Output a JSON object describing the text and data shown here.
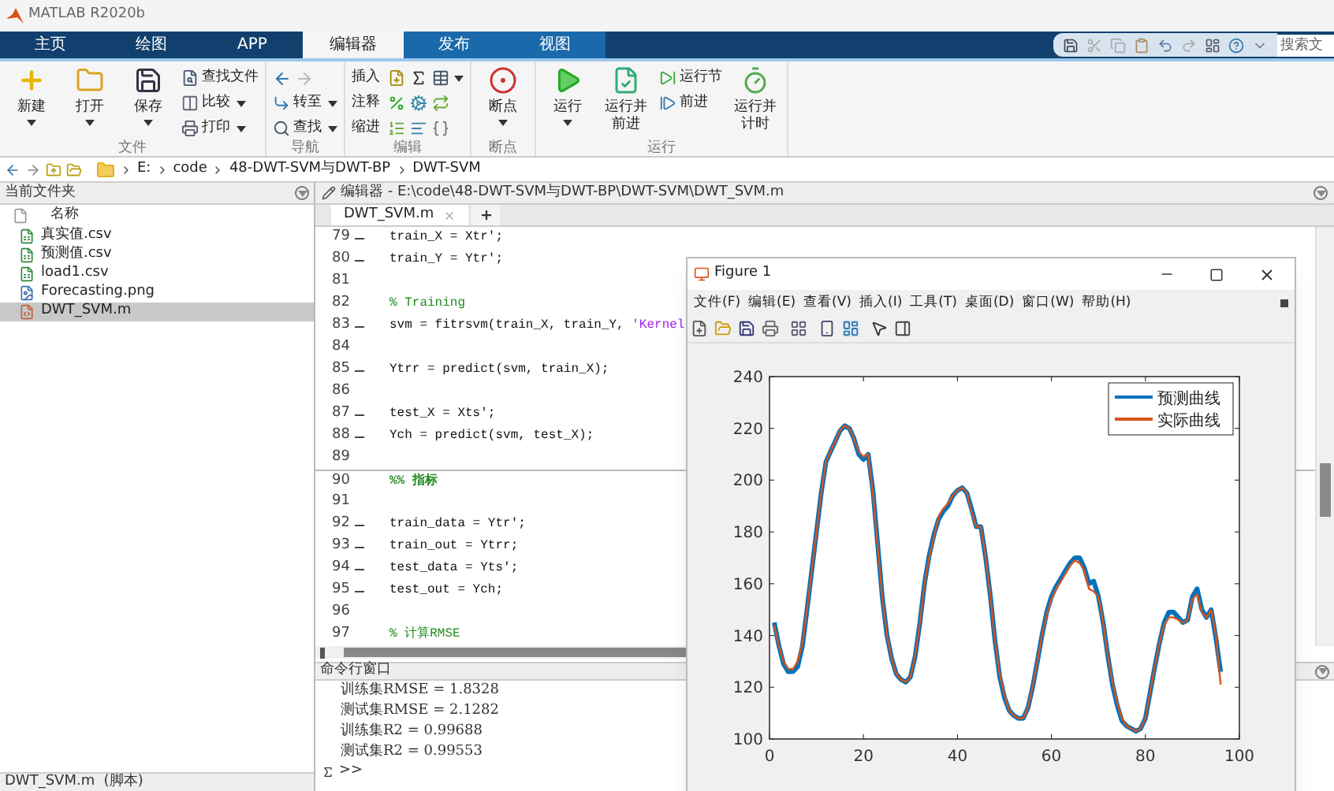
{
  "app_title": "MATLAB R2020b",
  "tabs": [
    {
      "label": "主页",
      "selected": false,
      "contextual": false
    },
    {
      "label": "绘图",
      "selected": false,
      "contextual": false
    },
    {
      "label": "APP",
      "selected": false,
      "contextual": false
    },
    {
      "label": "编辑器",
      "selected": true,
      "contextual": true
    },
    {
      "label": "发布",
      "selected": false,
      "contextual": true
    },
    {
      "label": "视图",
      "selected": false,
      "contextual": true
    }
  ],
  "search": {
    "placeholder": "搜索文"
  },
  "ribbon": {
    "groups": [
      {
        "title": "文件",
        "items": [
          {
            "kind": "large",
            "label": "新建",
            "dropdown": true
          },
          {
            "kind": "large",
            "label": "打开",
            "dropdown": true
          },
          {
            "kind": "large",
            "label": "保存",
            "dropdown": true
          },
          {
            "kind": "small",
            "label": "查找文件",
            "dropdown": false
          },
          {
            "kind": "small",
            "label": "比较",
            "dropdown": true
          },
          {
            "kind": "small",
            "label": "打印",
            "dropdown": true
          }
        ]
      },
      {
        "title": "导航",
        "items": [
          {
            "kind": "arrows"
          },
          {
            "kind": "small",
            "label": "转至",
            "dropdown": true
          },
          {
            "kind": "small",
            "label": "查找",
            "dropdown": true
          }
        ]
      },
      {
        "title": "编辑",
        "items": [
          {
            "kind": "tools",
            "label": "插入",
            "dropdown": true
          },
          {
            "kind": "tools",
            "label": "注释",
            "dropdown": false
          },
          {
            "kind": "tools",
            "label": "缩进",
            "dropdown": false
          }
        ]
      },
      {
        "title": "断点",
        "items": [
          {
            "kind": "large",
            "label": "断点",
            "dropdown": true
          }
        ]
      },
      {
        "title": "运行",
        "items": [
          {
            "kind": "large",
            "label": "运行",
            "dropdown": true
          },
          {
            "kind": "large",
            "label": "运行并前进",
            "dropdown": false
          },
          {
            "kind": "small",
            "label": "运行节",
            "dropdown": false
          },
          {
            "kind": "small",
            "label": "前进",
            "dropdown": false
          },
          {
            "kind": "large",
            "label": "运行并计时",
            "dropdown": false
          }
        ]
      }
    ]
  },
  "address": {
    "path": [
      "E:",
      "code",
      "48-DWT-SVM与DWT-BP",
      "DWT-SVM"
    ]
  },
  "files": {
    "title": "当前文件夹",
    "column": "名称",
    "items": [
      {
        "name": "真实值.csv",
        "kind": "csv",
        "selected": false
      },
      {
        "name": "预测值.csv",
        "kind": "csv",
        "selected": false
      },
      {
        "name": "load1.csv",
        "kind": "csv",
        "selected": false
      },
      {
        "name": "Forecasting.png",
        "kind": "png",
        "selected": false
      },
      {
        "name": "DWT_SVM.m",
        "kind": "m",
        "selected": true
      }
    ],
    "details": "DWT_SVM.m  (脚本)"
  },
  "editor": {
    "title": "编辑器 - E:\\code\\48-DWT-SVM与DWT-BP\\DWT-SVM\\DWT_SVM.m",
    "tabs": [
      {
        "label": "DWT_SVM.m",
        "selected": true
      }
    ],
    "lines": [
      {
        "number": "79",
        "executable": true,
        "segments": [
          {
            "kind": "code",
            "text": "train_X = Xtr';"
          }
        ]
      },
      {
        "number": "80",
        "executable": true,
        "segments": [
          {
            "kind": "code",
            "text": "train_Y = Ytr';"
          }
        ]
      },
      {
        "number": "81",
        "executable": false
      },
      {
        "number": "82",
        "executable": false,
        "segments": [
          {
            "kind": "comment",
            "text": "% Training"
          }
        ]
      },
      {
        "number": "83",
        "executable": true,
        "segments": [
          {
            "kind": "code",
            "text": "svm = fitrsvm(train_X, train_Y, "
          },
          {
            "kind": "string",
            "text": "'Kernel"
          }
        ]
      },
      {
        "number": "84",
        "executable": false
      },
      {
        "number": "85",
        "executable": true,
        "segments": [
          {
            "kind": "code",
            "text": "Ytrr = predict(svm, train_X);"
          }
        ]
      },
      {
        "number": "86",
        "executable": false
      },
      {
        "number": "87",
        "executable": true,
        "segments": [
          {
            "kind": "code",
            "text": "test_X = Xts';"
          }
        ]
      },
      {
        "number": "88",
        "executable": true,
        "segments": [
          {
            "kind": "code",
            "text": "Ych = predict(svm, test_X);"
          }
        ]
      },
      {
        "number": "89",
        "executable": false
      },
      {
        "number": "90",
        "executable": false,
        "segments": [
          {
            "kind": "section",
            "text": "%% 指标"
          }
        ]
      },
      {
        "number": "91",
        "executable": false
      },
      {
        "number": "92",
        "executable": true,
        "segments": [
          {
            "kind": "code",
            "text": "train_data = Ytr';"
          }
        ]
      },
      {
        "number": "93",
        "executable": true,
        "segments": [
          {
            "kind": "code",
            "text": "train_out = Ytrr;"
          }
        ]
      },
      {
        "number": "94",
        "executable": true,
        "segments": [
          {
            "kind": "code",
            "text": "test_data = Yts';"
          }
        ]
      },
      {
        "number": "95",
        "executable": true,
        "segments": [
          {
            "kind": "code",
            "text": "test_out = Ych;"
          }
        ]
      },
      {
        "number": "96",
        "executable": false
      },
      {
        "number": "97",
        "executable": false,
        "segments": [
          {
            "kind": "comment",
            "text": "% 计算RMSE"
          }
        ]
      }
    ]
  },
  "command_window": {
    "title": "命令行窗口",
    "output": [
      "训练集RMSE = 1.8328",
      "测试集RMSE = 2.1282",
      "训练集R2 = 0.99688",
      "测试集R2 = 0.99553"
    ],
    "prompt": ">>"
  },
  "figure": {
    "title": "Figure 1",
    "menu": [
      "文件(F)",
      "编辑(E)",
      "查看(V)",
      "插入(I)",
      "工具(T)",
      "桌面(D)",
      "窗口(W)",
      "帮助(H)"
    ],
    "chart_data": {
      "type": "line",
      "x": [
        1,
        2,
        3,
        4,
        5,
        6,
        7,
        8,
        9,
        10,
        11,
        12,
        13,
        14,
        15,
        16,
        17,
        18,
        19,
        20,
        21,
        22,
        23,
        24,
        25,
        26,
        27,
        28,
        29,
        30,
        31,
        32,
        33,
        34,
        35,
        36,
        37,
        38,
        39,
        40,
        41,
        42,
        43,
        44,
        45,
        46,
        47,
        48,
        49,
        50,
        51,
        52,
        53,
        54,
        55,
        56,
        57,
        58,
        59,
        60,
        61,
        62,
        63,
        64,
        65,
        66,
        67,
        68,
        69,
        70,
        71,
        72,
        73,
        74,
        75,
        76,
        77,
        78,
        79,
        80,
        81,
        82,
        83,
        84,
        85,
        86,
        87,
        88,
        89,
        90,
        91,
        92,
        93,
        94,
        95,
        96
      ],
      "series": [
        {
          "name": "预测曲线",
          "color": "#0072bd",
          "values": [
            145,
            136,
            129,
            126,
            126,
            128,
            136,
            150,
            165,
            180,
            195,
            207,
            211,
            215,
            219,
            221,
            220,
            216,
            210,
            208,
            210,
            196,
            176,
            155,
            140,
            131,
            125,
            123,
            122,
            124,
            132,
            145,
            160,
            171,
            179,
            185,
            188,
            190,
            194,
            196,
            197,
            195,
            189,
            182,
            182,
            170,
            155,
            138,
            124,
            116,
            111,
            109,
            108,
            108,
            112,
            120,
            130,
            140,
            149,
            155,
            159,
            162,
            165,
            168,
            170,
            170,
            166,
            160,
            161,
            155,
            145,
            132,
            121,
            113,
            107,
            105,
            104,
            103,
            104,
            108,
            118,
            128,
            137,
            145,
            149,
            149,
            147,
            145,
            146,
            155,
            158,
            150,
            147,
            150,
            139,
            126
          ]
        },
        {
          "name": "实际曲线",
          "color": "#d95319",
          "values": [
            144,
            136,
            130,
            127,
            127,
            130,
            137,
            150,
            165,
            180,
            195,
            207,
            211,
            215,
            219,
            221,
            220,
            216,
            211,
            209,
            210,
            195,
            175,
            155,
            140,
            131,
            125,
            123,
            122,
            124,
            132,
            145,
            160,
            170,
            178,
            186,
            189,
            191,
            194,
            196,
            197,
            195,
            188,
            182,
            182,
            170,
            155,
            138,
            125,
            117,
            111,
            109,
            108,
            108,
            112,
            120,
            130,
            140,
            148,
            154,
            158,
            161,
            164,
            167,
            169,
            168,
            165,
            158,
            157,
            155,
            145,
            132,
            122,
            114,
            108,
            105,
            104,
            103,
            104,
            108,
            118,
            128,
            137,
            144,
            147,
            147,
            146,
            145,
            146,
            154,
            156,
            149,
            147,
            150,
            140,
            121
          ]
        }
      ],
      "xlim": [
        0,
        100
      ],
      "ylim": [
        100,
        240
      ],
      "legend": "upper right",
      "xticks": [
        0,
        20,
        40,
        60,
        80,
        100
      ],
      "yticks": [
        100,
        120,
        140,
        160,
        180,
        200,
        220,
        240
      ]
    }
  }
}
